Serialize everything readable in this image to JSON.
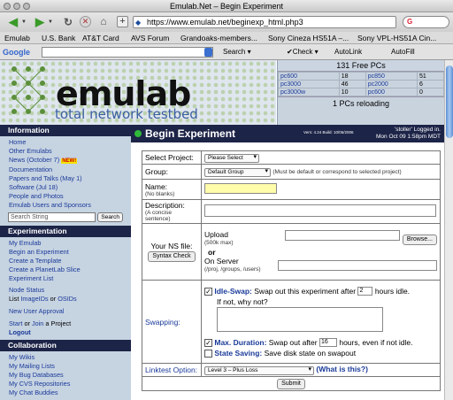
{
  "window": {
    "title": "Emulab.Net – Begin Experiment"
  },
  "toolbar": {
    "url": "https://www.emulab.net/beginexp_html.php3",
    "search_engine": "G"
  },
  "bookmarks": [
    "Emulab",
    "U.S. Bank",
    "AT&T Card",
    "AVS Forum",
    "Grandoaks-members...",
    "Sony Cineza HS51A –...",
    "Sony VPL-HS51A Cin..."
  ],
  "googlebar": {
    "logo": "Google",
    "search_label": "Search",
    "check_label": "Check",
    "autolink_label": "AutoLink",
    "autofill_label": "AutoFill"
  },
  "banner": {
    "logo": "emulab",
    "tagline": "total network testbed"
  },
  "pcs": {
    "free": "131 Free PCs",
    "rows": [
      [
        "pc600",
        "18",
        "pc850",
        "51"
      ],
      [
        "pc3000",
        "46",
        "pc2000",
        "6"
      ],
      [
        "pc3000w",
        "10",
        "pc600",
        "0"
      ]
    ],
    "reloading": "1 PCs reloading"
  },
  "sidebar": {
    "info_head": "Information",
    "info_links": [
      "Home",
      "Other Emulabs",
      "News (October 7)",
      "Documentation",
      "Papers and Talks (May 1)",
      "Software (Jul 18)",
      "People and Photos",
      "Emulab Users and Sponsors"
    ],
    "new_badge": "NEW!",
    "search_placeholder": "Search String",
    "search_btn": "Search",
    "exp_head": "Experimentation",
    "exp_links": [
      "My Emulab",
      "Begin an Experiment",
      "Create a Template",
      "Create a PlanetLab Slice",
      "Experiment List"
    ],
    "node_status": "Node Status",
    "list_prefix": "List",
    "list_imageids": "ImageIDs",
    "list_or": "or",
    "list_osids": "OSIDs",
    "new_user": "New User Approval",
    "start": "Start",
    "or": "or",
    "join": "Join",
    "project": "a Project",
    "logout": "Logout",
    "collab_head": "Collaboration",
    "collab_links": [
      "My Wikis",
      "My Mailing Lists",
      "My Bug Databases",
      "My CVS Repositories",
      "My Chat Buddies"
    ]
  },
  "main": {
    "title": "Begin Experiment",
    "version": "Vers: 4.24 Build: 10/05/2006",
    "login_line1": "'stoller' Logged in.",
    "login_line2": "Mon Oct 09 1:58pm MDT",
    "select_project_label": "Select Project:",
    "select_project_value": "Please Select",
    "group_label": "Group:",
    "group_value": "Default Group",
    "group_note": "(Must be default or correspond to selected project)",
    "name_label": "Name:",
    "name_note": "(No blanks)",
    "desc_label": "Description:",
    "desc_note": "(A concise sentence)",
    "ns_label": "Your NS file:",
    "syntax_btn": "Syntax Check",
    "upload_label": "Upload",
    "upload_note": "(500k max)",
    "browse_btn": "Browse...",
    "or_label": "or",
    "server_label": "On Server",
    "server_note": "(/proj, /groups, /users)",
    "swapping_label": "Swapping:",
    "idle_swap_label": "Idle-Swap:",
    "idle_swap_text1": "Swap out this experiment after",
    "idle_swap_hours": "2",
    "idle_swap_text2": "hours idle.",
    "why_not": "If not, why not?",
    "max_dur_label": "Max. Duration:",
    "max_dur_text1": "Swap out after",
    "max_dur_hours": "16",
    "max_dur_text2": "hours, even if not idle.",
    "state_saving_label": "State Saving:",
    "state_saving_text": "Save disk state on swapout",
    "linktest_label": "Linktest Option:",
    "linktest_value": "Level 3 – Plus Loss",
    "whatisthis": "(What is this?)",
    "submit": "Submit"
  },
  "colors": {
    "nav_dark": "#1c2447",
    "sidebar_bg": "#c6d3e1",
    "name_field": "#fffcaa"
  }
}
